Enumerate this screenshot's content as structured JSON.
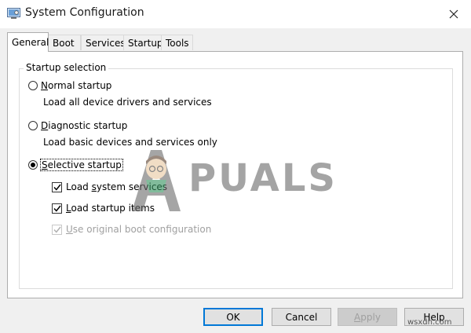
{
  "window": {
    "title": "System Configuration",
    "close_glyph": "✕"
  },
  "tabs": [
    {
      "label": "General",
      "active": true
    },
    {
      "label": "Boot",
      "active": false
    },
    {
      "label": "Services",
      "active": false
    },
    {
      "label": "Startup",
      "active": false
    },
    {
      "label": "Tools",
      "active": false
    }
  ],
  "startup_selection": {
    "group_label": "Startup selection",
    "normal": {
      "label_access": "N",
      "label_rest": "ormal startup",
      "description": "Load all device drivers and services",
      "checked": false
    },
    "diagnostic": {
      "label_access": "D",
      "label_rest": "iagnostic startup",
      "description": "Load basic devices and services only",
      "checked": false
    },
    "selective": {
      "label_access": "S",
      "label_rest": "elective startup",
      "checked": true
    },
    "options": {
      "load_system_services": {
        "prefix": "Load ",
        "access": "s",
        "rest": "ystem services",
        "checked": true,
        "enabled": true
      },
      "load_startup_items": {
        "prefix": "",
        "access": "L",
        "rest": "oad startup items",
        "checked": true,
        "enabled": true
      },
      "use_original_boot": {
        "prefix": "",
        "access": "U",
        "rest": "se original boot configuration",
        "checked": true,
        "enabled": false
      }
    }
  },
  "buttons": {
    "ok": "OK",
    "cancel": "Cancel",
    "apply_access": "A",
    "apply_rest": "pply",
    "help": "Help"
  },
  "watermark": {
    "text": "PUALS",
    "site": "wsxdn.com"
  },
  "colors": {
    "accent": "#0078d7",
    "dialog_bg": "#f0f0f0",
    "disabled_text": "#a0a0a0"
  },
  "icons": {
    "app": "system-configuration-icon",
    "close": "close-icon",
    "checkmark": "checkmark-icon"
  }
}
